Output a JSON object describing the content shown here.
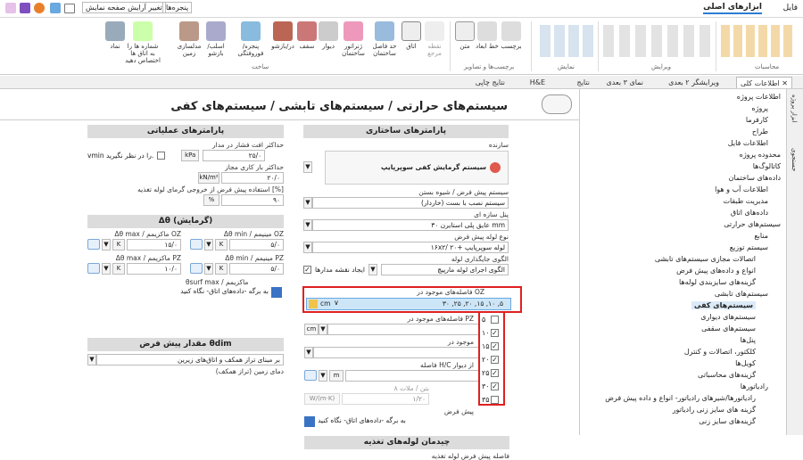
{
  "topbar": {
    "tab_file": "فایل",
    "tab_main": "ابزارهای اصلی",
    "windows": "پنجره‌ها",
    "change_view": "تغییر آرایش صفحه نمایش"
  },
  "ribbon": {
    "buttons": [
      {
        "label": "نماد"
      },
      {
        "label": "شماره ها را به اتاق ها اختصاص دهید"
      },
      {
        "label": "مدلسازی زمین"
      },
      {
        "label": "اسلب/بازشو"
      },
      {
        "label": "پنجره/فوروفتگی"
      },
      {
        "label": "در/بازشو"
      },
      {
        "label": "سقف"
      },
      {
        "label": "دیوار"
      },
      {
        "label": "ژنراتور ساختمان"
      },
      {
        "label": "حد فاصل ساختمان"
      },
      {
        "label": "اتاق"
      },
      {
        "label": "نقطه مرجع"
      },
      {
        "label": "متن"
      },
      {
        "label": "خط ابعاد"
      },
      {
        "label": "برچسب"
      }
    ],
    "groups": {
      "build": "ساخت",
      "labels": "برچسب‌ها و تصاویر",
      "view": "نمایش",
      "edit": "ویرایش",
      "calc": "محاسبات"
    }
  },
  "doctabs": [
    "اطلاعات کلی",
    "ویرایشگر ۲ بعدی",
    "نمای ۳ بعدی",
    "نتایج",
    "H&E",
    "نتایج چاپی"
  ],
  "main": {
    "title": "سیستم‌های حرارتی / سیستم‌های تابشی / سیستم‌های کفی",
    "structural": {
      "header": "پارامترهای ساختاری",
      "manufacturer_label": "سازنده",
      "manufacturer_logo": "سیستم گرمایش کفی سوپرپایپ",
      "install_label": "سیستم پیش فرض / شیوه بستن",
      "install_value": "سیستم نصب با بست (خاردار)",
      "panel_label": "پنل سازه ای",
      "panel_value": "عایق پلی استایرن ۳۰ mm",
      "pipe_label": "نوع لوله پیش فرض",
      "pipe_value": "۱۶x۲/ لوله سوپرپایپ +۲۰",
      "pattern_label": "الگوی جایگذاری لوله",
      "pattern_value": "الگوی اجرای لوله مارپیچ",
      "draw_label": "ایجاد نقشه مدارها",
      "oz_label": "فاصله‌های موجود در OZ",
      "oz_value": "۳۰ ,۲۵ ,۲۰ ,۱۵ ,۱۰ ,۵",
      "oz_unit": "cm",
      "pz_label": "فاصله‌های موجود در PZ",
      "pz_unit": "cm",
      "mounted_label": "موجود در",
      "hc_label": "فاصله H/C از دیوار",
      "hc_unit": "m",
      "concrete_label": "۸ بتن / ملات",
      "concrete_value": "۱/۲۰",
      "concrete_unit": "W/(m·K)",
      "floor_label": "پیش فرض",
      "floor_text": "به برگه -داده‌های اتاق- نگاه کنید",
      "pipe_run_header": "چیدمان لوله‌های تغذیه",
      "pipe_run_label": "فاصله پیش فرض لوله تغذیه"
    },
    "dropdown_options": [
      {
        "value": "۵",
        "checked": false
      },
      {
        "value": "۱۰",
        "checked": true
      },
      {
        "value": "۱۵",
        "checked": true
      },
      {
        "value": "۲۰",
        "checked": true
      },
      {
        "value": "۲۵",
        "checked": true
      },
      {
        "value": "۳۰",
        "checked": true
      },
      {
        "value": "۳۵",
        "checked": false
      }
    ],
    "operational": {
      "header": "پارامترهای عملیاتی",
      "maxdp_label": "حداکثر افت فشار در مدار",
      "maxdp_value": "۲۵/۰",
      "maxdp_unit": "kPa",
      "vmin_label": "vmin را در نظر نگیرید.",
      "maxload_label": "حداکثر بار کاری مجاز",
      "maxload_value": "۲۰/۰",
      "maxload_unit": "kN/m²",
      "usage_label": "استفاده پیش فرض از خروجی گرمای لوله تغذیه [%]",
      "usage_value": "۹۰",
      "usage_unit": "%"
    },
    "heating": {
      "header": "Δθ (گرمایش)",
      "oz_min_label": "Δθ min / مینیمم OZ",
      "oz_min_value": "۵/۰",
      "oz_max_label": "Δθ max / ماکزیمم OZ",
      "oz_max_value": "۱۵/۰",
      "pz_min_label": "Δθ min / مینیمم PZ",
      "pz_min_value": "۵/۰",
      "pz_max_label": "Δθ max / ماکزیمم PZ",
      "pz_max_value": "۱۰/۰",
      "unit": "K",
      "surf_label": "θsurf max / ماکزیمم",
      "surf_text": "به برگه -داده‌های اتاق- نگاه کنید"
    },
    "default_header": "مقدار پیش فرض θdim",
    "default_value": "بر مبنای تراز همکف و اتاق‌های زیرین",
    "default_note": "دمای زمین (تراز همکف)"
  },
  "tree": [
    {
      "label": "اطلاعات پروژه",
      "level": 0
    },
    {
      "label": "پروژه",
      "level": 1
    },
    {
      "label": "کارفرما",
      "level": 1
    },
    {
      "label": "طراح",
      "level": 1
    },
    {
      "label": "اطلاعات فایل",
      "level": 1
    },
    {
      "label": "محدوده پروژه",
      "level": 0
    },
    {
      "label": "کاتالوگ‌ها",
      "level": 0
    },
    {
      "label": "داده‌های ساختمان",
      "level": 0
    },
    {
      "label": "اطلاعات آب و هوا",
      "level": 1
    },
    {
      "label": "مدیریت طبقات",
      "level": 1
    },
    {
      "label": "داده‌های اتاق",
      "level": 1
    },
    {
      "label": "سیستم‌های حرارتی",
      "level": 0
    },
    {
      "label": "منابع",
      "level": 1
    },
    {
      "label": "سیستم توزیع",
      "level": 1
    },
    {
      "label": "اتصالات مجازی سیستم‌های تابشی",
      "level": 2
    },
    {
      "label": "انواع و داده‌های پیش فرض",
      "level": 2
    },
    {
      "label": "گزینه‌های سایزبندی لوله‌ها",
      "level": 2
    },
    {
      "label": "سیستم‌های تابشی",
      "level": 1
    },
    {
      "label": "سیستم‌های کفی",
      "level": 2,
      "selected": true
    },
    {
      "label": "سیستم‌های دیواری",
      "level": 2
    },
    {
      "label": "سیستم‌های سقفی",
      "level": 2
    },
    {
      "label": "پنل‌ها",
      "level": 2
    },
    {
      "label": "کلکتور، اتصالات و کنترل",
      "level": 2
    },
    {
      "label": "کویل‌ها",
      "level": 2
    },
    {
      "label": "گزینه‌های محاسباتی",
      "level": 2
    },
    {
      "label": "رادیاتورها",
      "level": 1
    },
    {
      "label": "رادیاتورها/شیرهای رادیاتور- انواع و داده پیش فرض",
      "level": 2
    },
    {
      "label": "گزینه های سایز زنی رادیاتور",
      "level": 2
    },
    {
      "label": "گزینه‌های سایز زنی",
      "level": 2
    }
  ],
  "vstrip": {
    "top": "ابزار پروژه",
    "mid": "جستجوی"
  },
  "colors": {
    "accent": "#2b7cd3",
    "highlight": "#cde6f7",
    "red": "#e02020",
    "selected": "#dbeaf7"
  }
}
